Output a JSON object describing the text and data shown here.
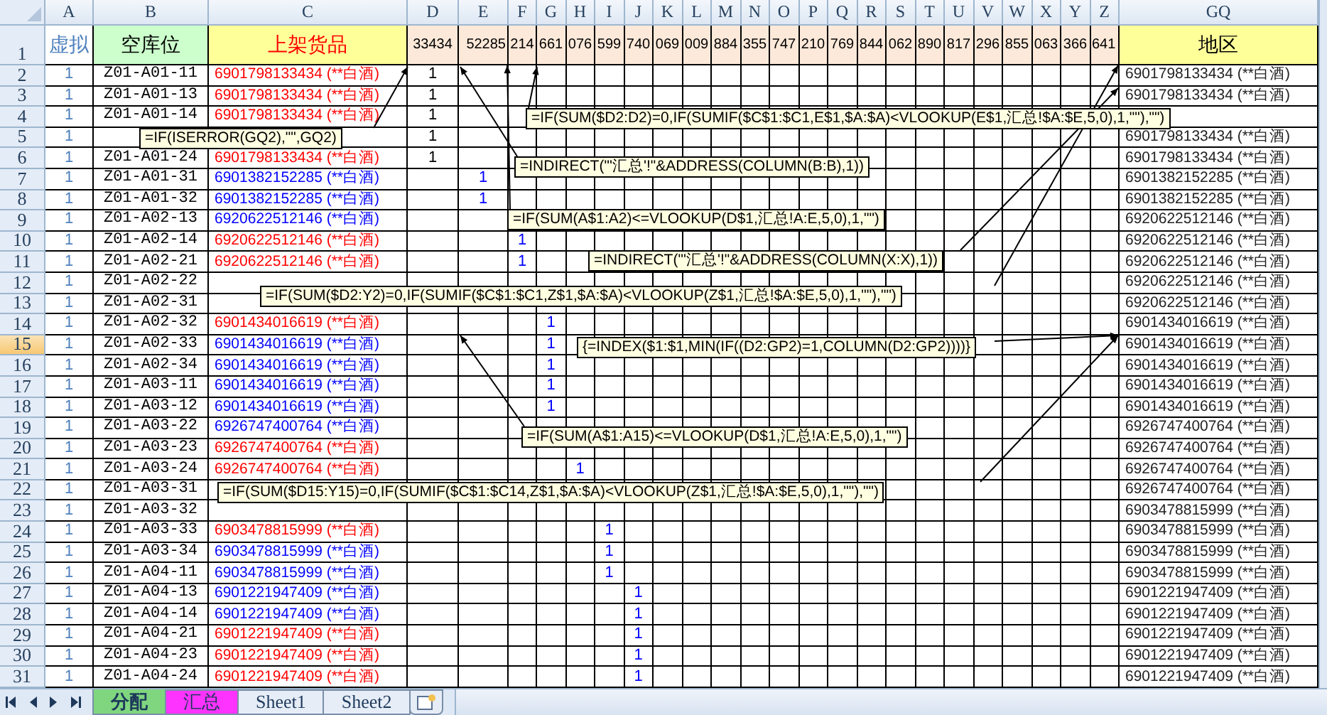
{
  "columns": {
    "a": "A",
    "b": "B",
    "c": "C",
    "grid": [
      "D",
      "E",
      "F",
      "G",
      "H",
      "I",
      "J",
      "K",
      "L",
      "M",
      "N",
      "O",
      "P",
      "Q",
      "R",
      "S",
      "T",
      "U",
      "V",
      "W",
      "X",
      "Y",
      "Z"
    ],
    "gq": "GQ"
  },
  "header_row": {
    "number": "1",
    "a": "虚拟",
    "b": "空库位",
    "c": "上架货品",
    "grid": [
      "33434",
      "52285",
      "214",
      "661",
      "076",
      "599",
      "740",
      "069",
      "009",
      "884",
      "355",
      "747",
      "210",
      "769",
      "844",
      "062",
      "890",
      "817",
      "296",
      "855",
      "063",
      "366",
      "641"
    ],
    "gq": "地区",
    "selected": false
  },
  "rows": [
    {
      "number": "2",
      "selected": false,
      "a": "1",
      "b": "Z01-A01-11",
      "c": "6901798133434 (**白酒)",
      "kind": "red",
      "d": {
        "text": "1",
        "kind": "black"
      },
      "gq": "6901798133434 (**白酒)"
    },
    {
      "number": "3",
      "selected": false,
      "a": "1",
      "b": "Z01-A01-13",
      "c": "6901798133434 (**白酒)",
      "kind": "red",
      "d": {
        "text": "1",
        "kind": "black"
      },
      "gq": "6901798133434 (**白酒)"
    },
    {
      "number": "4",
      "selected": false,
      "a": "1",
      "b": "Z01-A01-14",
      "c": "6901798133434 (**白酒)",
      "kind": "red",
      "d": {
        "text": "1",
        "kind": "black"
      }
    },
    {
      "number": "5",
      "selected": false,
      "a": "1",
      "d": {
        "text": "1",
        "kind": "black"
      },
      "gq": "6901798133434 (**白酒)"
    },
    {
      "number": "6",
      "selected": false,
      "a": "1",
      "b": "Z01-A01-24",
      "c": "6901798133434 (**白酒)",
      "kind": "red",
      "d": {
        "text": "1",
        "kind": "black"
      },
      "gq": "6901798133434 (**白酒)"
    },
    {
      "number": "7",
      "selected": false,
      "a": "1",
      "b": "Z01-A01-31",
      "c": "6901382152285 (**白酒)",
      "kind": "blue",
      "e": {
        "text": "1",
        "kind": "blue"
      },
      "gq": "6901382152285 (**白酒)"
    },
    {
      "number": "8",
      "selected": false,
      "a": "1",
      "b": "Z01-A01-32",
      "c": "6901382152285 (**白酒)",
      "kind": "blue",
      "e": {
        "text": "1",
        "kind": "blue"
      },
      "gq": "6901382152285 (**白酒)"
    },
    {
      "number": "9",
      "selected": false,
      "a": "1",
      "b": "Z01-A02-13",
      "c": "6920622512146 (**白酒)",
      "kind": "blue",
      "gq": "6920622512146 (**白酒)"
    },
    {
      "number": "10",
      "selected": false,
      "a": "1",
      "b": "Z01-A02-14",
      "c": "6920622512146 (**白酒)",
      "kind": "red",
      "f": {
        "text": "1",
        "kind": "blue"
      },
      "gq": "6920622512146 (**白酒)"
    },
    {
      "number": "11",
      "selected": false,
      "a": "1",
      "b": "Z01-A02-21",
      "c": "6920622512146 (**白酒)",
      "kind": "red",
      "f": {
        "text": "1",
        "kind": "blue"
      },
      "gq": "6920622512146 (**白酒)"
    },
    {
      "number": "12",
      "selected": false,
      "a": "1",
      "b": "Z01-A02-22",
      "gq": "6920622512146 (**白酒)"
    },
    {
      "number": "13",
      "selected": false,
      "a": "1",
      "b": "Z01-A02-31",
      "gq": "6920622512146 (**白酒)"
    },
    {
      "number": "14",
      "selected": false,
      "a": "1",
      "b": "Z01-A02-32",
      "c": "6901434016619 (**白酒)",
      "kind": "red",
      "g": {
        "text": "1",
        "kind": "blue"
      },
      "gq": "6901434016619 (**白酒)"
    },
    {
      "number": "15",
      "selected": true,
      "a": "1",
      "b": "Z01-A02-33",
      "c": "6901434016619 (**白酒)",
      "kind": "blue",
      "g": {
        "text": "1",
        "kind": "blue"
      },
      "gq": "6901434016619 (**白酒)"
    },
    {
      "number": "16",
      "selected": false,
      "a": "1",
      "b": "Z01-A02-34",
      "c": "6901434016619 (**白酒)",
      "kind": "blue",
      "g": {
        "text": "1",
        "kind": "blue"
      },
      "gq": "6901434016619 (**白酒)"
    },
    {
      "number": "17",
      "selected": false,
      "a": "1",
      "b": "Z01-A03-11",
      "c": "6901434016619 (**白酒)",
      "kind": "blue",
      "g": {
        "text": "1",
        "kind": "blue"
      },
      "gq": "6901434016619 (**白酒)"
    },
    {
      "number": "18",
      "selected": false,
      "a": "1",
      "b": "Z01-A03-12",
      "c": "6901434016619 (**白酒)",
      "kind": "blue",
      "g": {
        "text": "1",
        "kind": "blue"
      },
      "gq": "6901434016619 (**白酒)"
    },
    {
      "number": "19",
      "selected": false,
      "a": "1",
      "b": "Z01-A03-22",
      "c": "6926747400764 (**白酒)",
      "kind": "blue",
      "gq": "6926747400764 (**白酒)"
    },
    {
      "number": "20",
      "selected": false,
      "a": "1",
      "b": "Z01-A03-23",
      "c": "6926747400764 (**白酒)",
      "kind": "red",
      "gq": "6926747400764 (**白酒)"
    },
    {
      "number": "21",
      "selected": false,
      "a": "1",
      "b": "Z01-A03-24",
      "c": "6926747400764 (**白酒)",
      "kind": "red",
      "h": {
        "text": "1",
        "kind": "blue"
      },
      "gq": "6926747400764 (**白酒)"
    },
    {
      "number": "22",
      "selected": false,
      "a": "1",
      "b": "Z01-A03-31",
      "gq": "6926747400764 (**白酒)"
    },
    {
      "number": "23",
      "selected": false,
      "a": "1",
      "b": "Z01-A03-32",
      "gq": "6903478815999 (**白酒)"
    },
    {
      "number": "24",
      "selected": false,
      "a": "1",
      "b": "Z01-A03-33",
      "c": "6903478815999 (**白酒)",
      "kind": "red",
      "i": {
        "text": "1",
        "kind": "blue"
      },
      "gq": "6903478815999 (**白酒)"
    },
    {
      "number": "25",
      "selected": false,
      "a": "1",
      "b": "Z01-A03-34",
      "c": "6903478815999 (**白酒)",
      "kind": "blue",
      "i": {
        "text": "1",
        "kind": "blue"
      },
      "gq": "6903478815999 (**白酒)"
    },
    {
      "number": "26",
      "selected": false,
      "a": "1",
      "b": "Z01-A04-11",
      "c": "6903478815999 (**白酒)",
      "kind": "blue",
      "i": {
        "text": "1",
        "kind": "blue"
      },
      "gq": "6903478815999 (**白酒)"
    },
    {
      "number": "27",
      "selected": false,
      "a": "1",
      "b": "Z01-A04-13",
      "c": "6901221947409 (**白酒)",
      "kind": "blue",
      "j": {
        "text": "1",
        "kind": "blue"
      },
      "gq": "6901221947409 (**白酒)"
    },
    {
      "number": "28",
      "selected": false,
      "a": "1",
      "b": "Z01-A04-14",
      "c": "6901221947409 (**白酒)",
      "kind": "blue",
      "j": {
        "text": "1",
        "kind": "blue"
      },
      "gq": "6901221947409 (**白酒)"
    },
    {
      "number": "29",
      "selected": false,
      "a": "1",
      "b": "Z01-A04-21",
      "c": "6901221947409 (**白酒)",
      "kind": "red",
      "j": {
        "text": "1",
        "kind": "blue"
      },
      "gq": "6901221947409 (**白酒)"
    },
    {
      "number": "30",
      "selected": false,
      "a": "1",
      "b": "Z01-A04-23",
      "c": "6901221947409 (**白酒)",
      "kind": "red",
      "j": {
        "text": "1",
        "kind": "blue"
      },
      "gq": "6901221947409 (**白酒)"
    },
    {
      "number": "31",
      "selected": false,
      "a": "1",
      "b": "Z01-A04-24",
      "c": "6901221947409 (**白酒)",
      "kind": "red",
      "j": {
        "text": "1",
        "kind": "blue"
      },
      "gq": "6901221947409 (**白酒)"
    }
  ],
  "callouts": [
    {
      "text": "=IF(ISERROR(GQ2),\"\",GQ2)"
    },
    {
      "text": "=IF(SUM($D2:D2)=0,IF(SUMIF($C$1:$C1,E$1,$A:$A)<VLOOKUP(E$1,汇总!$A:$E,5,0),1,\"\"),\"\")"
    },
    {
      "text": "=INDIRECT(\"'汇总'!\"&ADDRESS(COLUMN(B:B),1))"
    },
    {
      "text": "=IF(SUM(A$1:A2)<=VLOOKUP(D$1,汇总!A:E,5,0),1,\"\")"
    },
    {
      "text": "=INDIRECT(\"'汇总'!\"&ADDRESS(COLUMN(X:X),1))"
    },
    {
      "text": "=IF(SUM($D2:Y2)=0,IF(SUMIF($C$1:$C1,Z$1,$A:$A)<VLOOKUP(Z$1,汇总!$A:$E,5,0),1,\"\"),\"\")"
    },
    {
      "text": "{=INDEX($1:$1,MIN(IF((D2:GP2)=1,COLUMN(D2:GP2))))}"
    },
    {
      "text": "=IF(SUM(A$1:A15)<=VLOOKUP(D$1,汇总!A:E,5,0),1,\"\")"
    },
    {
      "text": "=IF(SUM($D15:Y15)=0,IF(SUMIF($C$1:$C14,Z$1,$A:$A)<VLOOKUP(Z$1,汇总!$A:$E,5,0),1,\"\"),\"\")"
    }
  ],
  "sheet_tabs": [
    {
      "label": "分配",
      "selected": true,
      "color": "#7fd67f"
    },
    {
      "label": "汇总",
      "selected": false,
      "color": "#ff33ff"
    },
    {
      "label": "Sheet1",
      "selected": false,
      "color": "#e6edf7"
    },
    {
      "label": "Sheet2",
      "selected": false,
      "color": "#e6edf7"
    }
  ]
}
